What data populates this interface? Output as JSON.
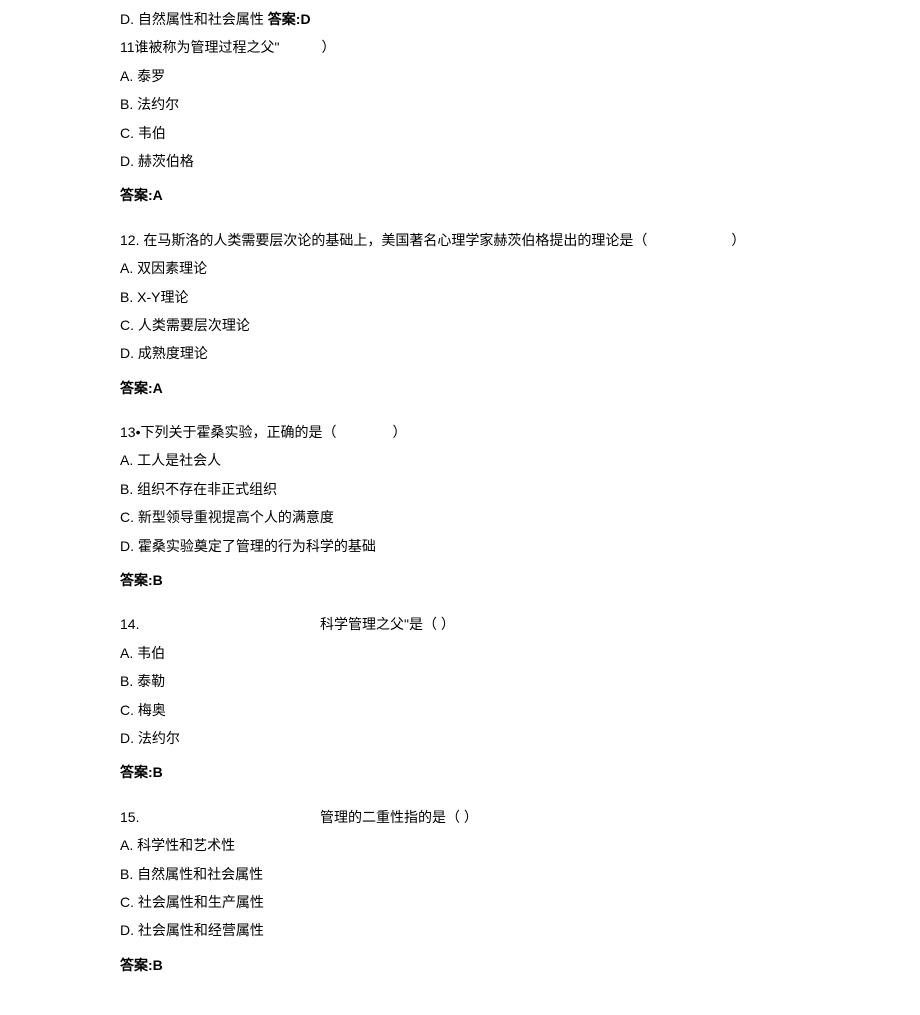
{
  "q10": {
    "optionD": "D. 自然属性和社会属性",
    "answerLabel": "答案:D"
  },
  "q11": {
    "question": "11谁被称为管理过程之父\"　　　）",
    "optionA": "A. 泰罗",
    "optionB": "B. 法约尔",
    "optionC": "C. 韦伯",
    "optionD": "D. 赫茨伯格",
    "answer": "答案:A"
  },
  "q12": {
    "question": "12. 在马斯洛的人类需要层次论的基础上，美国著名心理学家赫茨伯格提出的理论是（　　　　　　）",
    "optionA": "A. 双因素理论",
    "optionB": "B. X-Y理论",
    "optionC": "C. 人类需要层次理论",
    "optionD": "D. 成熟度理论",
    "answer": "答案:A"
  },
  "q13": {
    "question": "13•下列关于霍桑实验，正确的是（　　　　）",
    "optionA": "A. 工人是社会人",
    "optionB": "B. 组织不存在非正式组织",
    "optionC": "C. 新型领导重视提高个人的满意度",
    "optionD": "D. 霍桑实验奠定了管理的行为科学的基础",
    "answer": "答案:B"
  },
  "q14": {
    "number": "14.",
    "question": "科学管理之父\"是（  ）",
    "optionA": "A. 韦伯",
    "optionB": "B.  泰勒",
    "optionC": "C. 梅奥",
    "optionD": "D. 法约尔",
    "answer": "答案:B"
  },
  "q15": {
    "number": "15.",
    "question": "管理的二重性指的是（   ）",
    "optionA": "A. 科学性和艺术性",
    "optionB": "B. 自然属性和社会属性",
    "optionC": "C. 社会属性和生产属性",
    "optionD": "D. 社会属性和经营属性",
    "answer": "答案:B"
  }
}
